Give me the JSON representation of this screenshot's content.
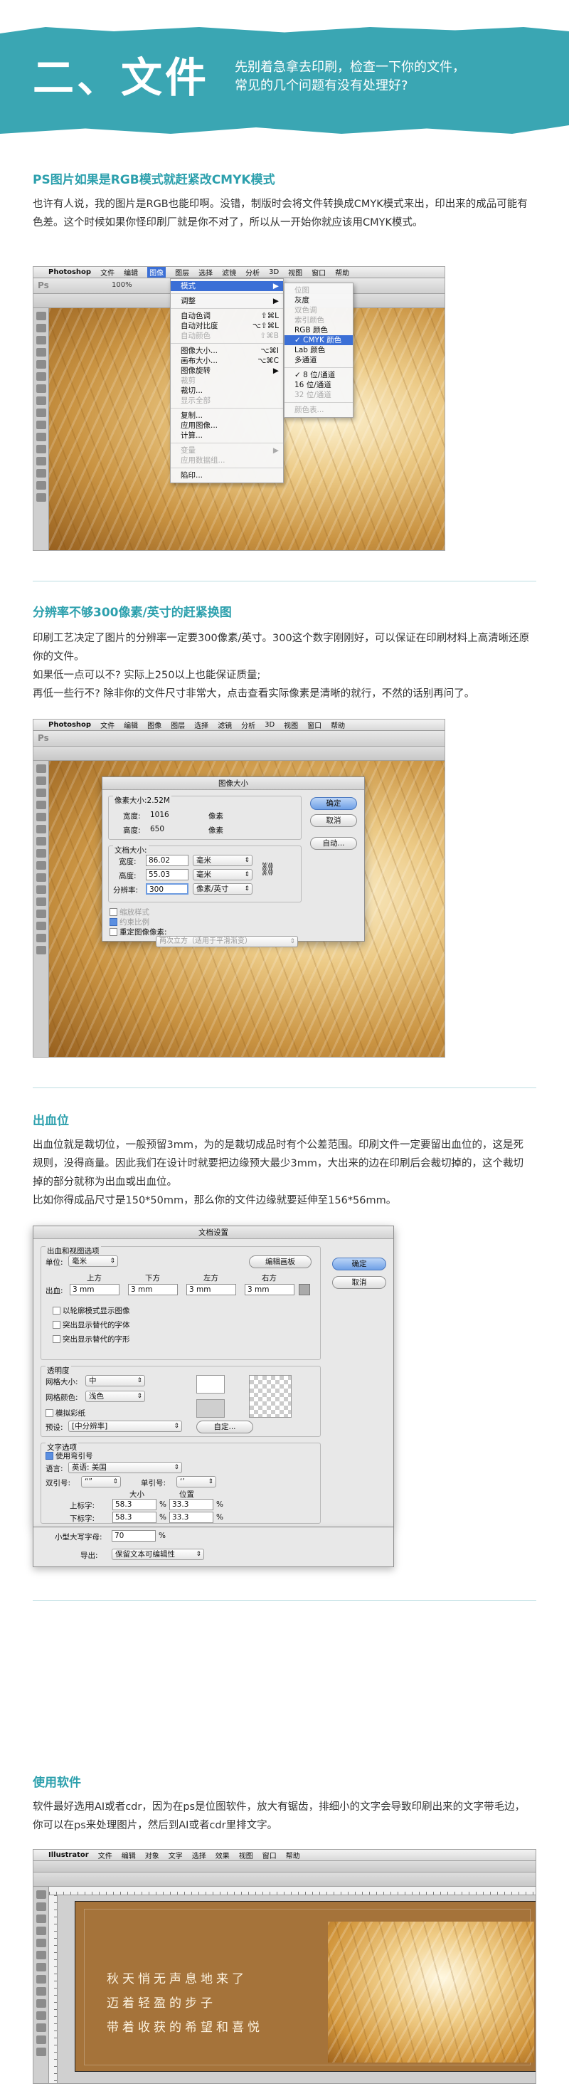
{
  "header": {
    "title": "二、文件",
    "subtitle_line1": "先别着急拿去印刷，检查一下你的文件，",
    "subtitle_line2": "常见的几个问题有没有处理好?"
  },
  "sections": [
    {
      "heading": "PS图片如果是RGB模式就赶紧改CMYK模式",
      "text": "也许有人说，我的图片是RGB也能印啊。没错，制版时会将文件转换成CMYK模式来出，印出来的成品可能有色差。这个时候如果你怪印刷厂就是你不对了，所以从一开始你就应该用CMYK模式。"
    },
    {
      "heading": "分辨率不够300像素/英寸的赶紧换图",
      "lines": [
        "印刷工艺决定了图片的分辨率一定要300像素/英寸。300这个数字刚刚好，可以保证在印刷材料上高清晰还原你的文件。",
        "如果低一点可以不? 实际上250以上也能保证质量;",
        "再低一些行不? 除非你的文件尺寸非常大，点击查看实际像素是清晰的就行，不然的话别再问了。"
      ]
    },
    {
      "heading": "出血位",
      "text": "出血位就是裁切位，一般预留3mm，为的是裁切成品时有个公差范围。印刷文件一定要留出血位的，这是死规则，没得商量。因此我们在设计时就要把边缘预大最少3mm，大出来的边在印刷后会裁切掉的，这个裁切掉的部分就称为出血或出血位。",
      "text2": "比如你得成品尺寸是150*50mm，那么你的文件边缘就要延伸至156*56mm。"
    },
    {
      "heading": "使用软件",
      "text": "软件最好选用AI或者cdr，因为在ps是位图软件，放大有锯齿，排细小的文字会导致印刷出来的文字带毛边，你可以在ps来处理图片，然后到AI或者cdr里排文字。"
    }
  ],
  "ps_menubar": [
    "Photoshop",
    "文件",
    "编辑",
    "图像",
    "图层",
    "选择",
    "滤镜",
    "分析",
    "3D",
    "视图",
    "窗口",
    "帮助"
  ],
  "ps_zoom": "100%",
  "image_menu": {
    "items": [
      {
        "label": "模式",
        "shortcut": "▶",
        "state": "selected"
      },
      {
        "sep": true
      },
      {
        "label": "调整",
        "shortcut": "▶",
        "state": "normal"
      },
      {
        "sep": true
      },
      {
        "label": "自动色调",
        "shortcut": "⇧⌘L",
        "state": "normal"
      },
      {
        "label": "自动对比度",
        "shortcut": "⌥⇧⌘L",
        "state": "normal"
      },
      {
        "label": "自动颜色",
        "shortcut": "⇧⌘B",
        "state": "disabled"
      },
      {
        "sep": true
      },
      {
        "label": "图像大小...",
        "shortcut": "⌥⌘I",
        "state": "normal"
      },
      {
        "label": "画布大小...",
        "shortcut": "⌥⌘C",
        "state": "normal"
      },
      {
        "label": "图像旋转",
        "shortcut": "▶",
        "state": "normal"
      },
      {
        "label": "裁剪",
        "shortcut": "",
        "state": "disabled"
      },
      {
        "label": "裁切...",
        "shortcut": "",
        "state": "normal"
      },
      {
        "label": "显示全部",
        "shortcut": "",
        "state": "disabled"
      },
      {
        "sep": true
      },
      {
        "label": "复制...",
        "shortcut": "",
        "state": "normal"
      },
      {
        "label": "应用图像...",
        "shortcut": "",
        "state": "normal"
      },
      {
        "label": "计算...",
        "shortcut": "",
        "state": "normal"
      },
      {
        "sep": true
      },
      {
        "label": "变量",
        "shortcut": "▶",
        "state": "disabled"
      },
      {
        "label": "应用数据组...",
        "shortcut": "",
        "state": "disabled"
      },
      {
        "sep": true
      },
      {
        "label": "陷印...",
        "shortcut": "",
        "state": "normal"
      }
    ]
  },
  "mode_menu": {
    "items": [
      {
        "label": "位图",
        "state": "disabled"
      },
      {
        "label": "灰度",
        "state": "normal"
      },
      {
        "label": "双色调",
        "state": "disabled"
      },
      {
        "label": "索引颜色",
        "state": "disabled"
      },
      {
        "label": "RGB 颜色",
        "state": "normal"
      },
      {
        "label": "✓ CMYK 颜色",
        "state": "selected"
      },
      {
        "label": "Lab 颜色",
        "state": "normal"
      },
      {
        "label": "多通道",
        "state": "normal"
      },
      {
        "sep": true
      },
      {
        "label": "✓ 8 位/通道",
        "state": "normal"
      },
      {
        "label": "16 位/通道",
        "state": "normal"
      },
      {
        "label": "32 位/通道",
        "state": "disabled"
      },
      {
        "sep": true
      },
      {
        "label": "颜色表...",
        "state": "disabled"
      }
    ]
  },
  "image_size_dialog": {
    "title": "图像大小",
    "pixel_size": "像素大小:2.52M",
    "px_width_label": "宽度:",
    "px_width": "1016",
    "px_unit": "像素",
    "px_height_label": "高度:",
    "px_height": "650",
    "doc_size": "文档大小:",
    "doc_width_label": "宽度:",
    "doc_width": "86.02",
    "doc_unit": "毫米",
    "doc_height_label": "高度:",
    "doc_height": "55.03",
    "res_label": "分辨率:",
    "res_value": "300",
    "res_unit": "像素/英寸",
    "scale_styles": "缩放样式",
    "constrain": "约束比例",
    "resample": "重定图像像素:",
    "resample_method": "两次立方（适用于平滑渐变）",
    "ok": "确定",
    "cancel": "取消",
    "auto": "自动..."
  },
  "doc_setup_dialog": {
    "title": "文档设置",
    "group_bleed": "出血和视图选项",
    "unit_label": "单位:",
    "unit": "毫米",
    "edit_artboard": "编辑画板",
    "top": "上方",
    "bottom": "下方",
    "left": "左方",
    "right": "右方",
    "bleed_label": "出血:",
    "bleed_value": "3 mm",
    "opt1": "以轮廓模式显示图像",
    "opt2": "突出显示替代的字体",
    "opt3": "突出显示替代的字形",
    "group_transparency": "透明度",
    "grid_size_label": "网格大小:",
    "grid_size": "中",
    "grid_color_label": "网格颜色:",
    "grid_color": "浅色",
    "simulate_paper": "模拟彩纸",
    "preset_label": "预设:",
    "preset": "[中分辨率]",
    "custom": "自定...",
    "group_text": "文字选项",
    "use_quotes": "使用弯引号",
    "lang_label": "语言:",
    "lang": "英语: 美国",
    "dq_label": "双引号:",
    "dq": "“”",
    "sq_label": "单引号:",
    "sq": "‘’",
    "size_header": "大小",
    "pos_header": "位置",
    "super_label": "上标字:",
    "super_size": "58.3",
    "super_pos": "33.3",
    "sub_label": "下标字:",
    "sub_size": "58.3",
    "sub_pos": "33.3",
    "smallcaps_label": "小型大写字母:",
    "smallcaps": "70",
    "pct": "%",
    "export_label": "导出:",
    "export": "保留文本可编辑性",
    "ok": "确定",
    "cancel": "取消"
  },
  "illustrator": {
    "menubar": [
      "Illustrator",
      "文件",
      "编辑",
      "对象",
      "文字",
      "选择",
      "效果",
      "视图",
      "窗口",
      "帮助"
    ],
    "poem": [
      "秋天悄无声息地来了",
      "迈着轻盈的步子",
      "带着收获的希望和喜悦"
    ]
  }
}
